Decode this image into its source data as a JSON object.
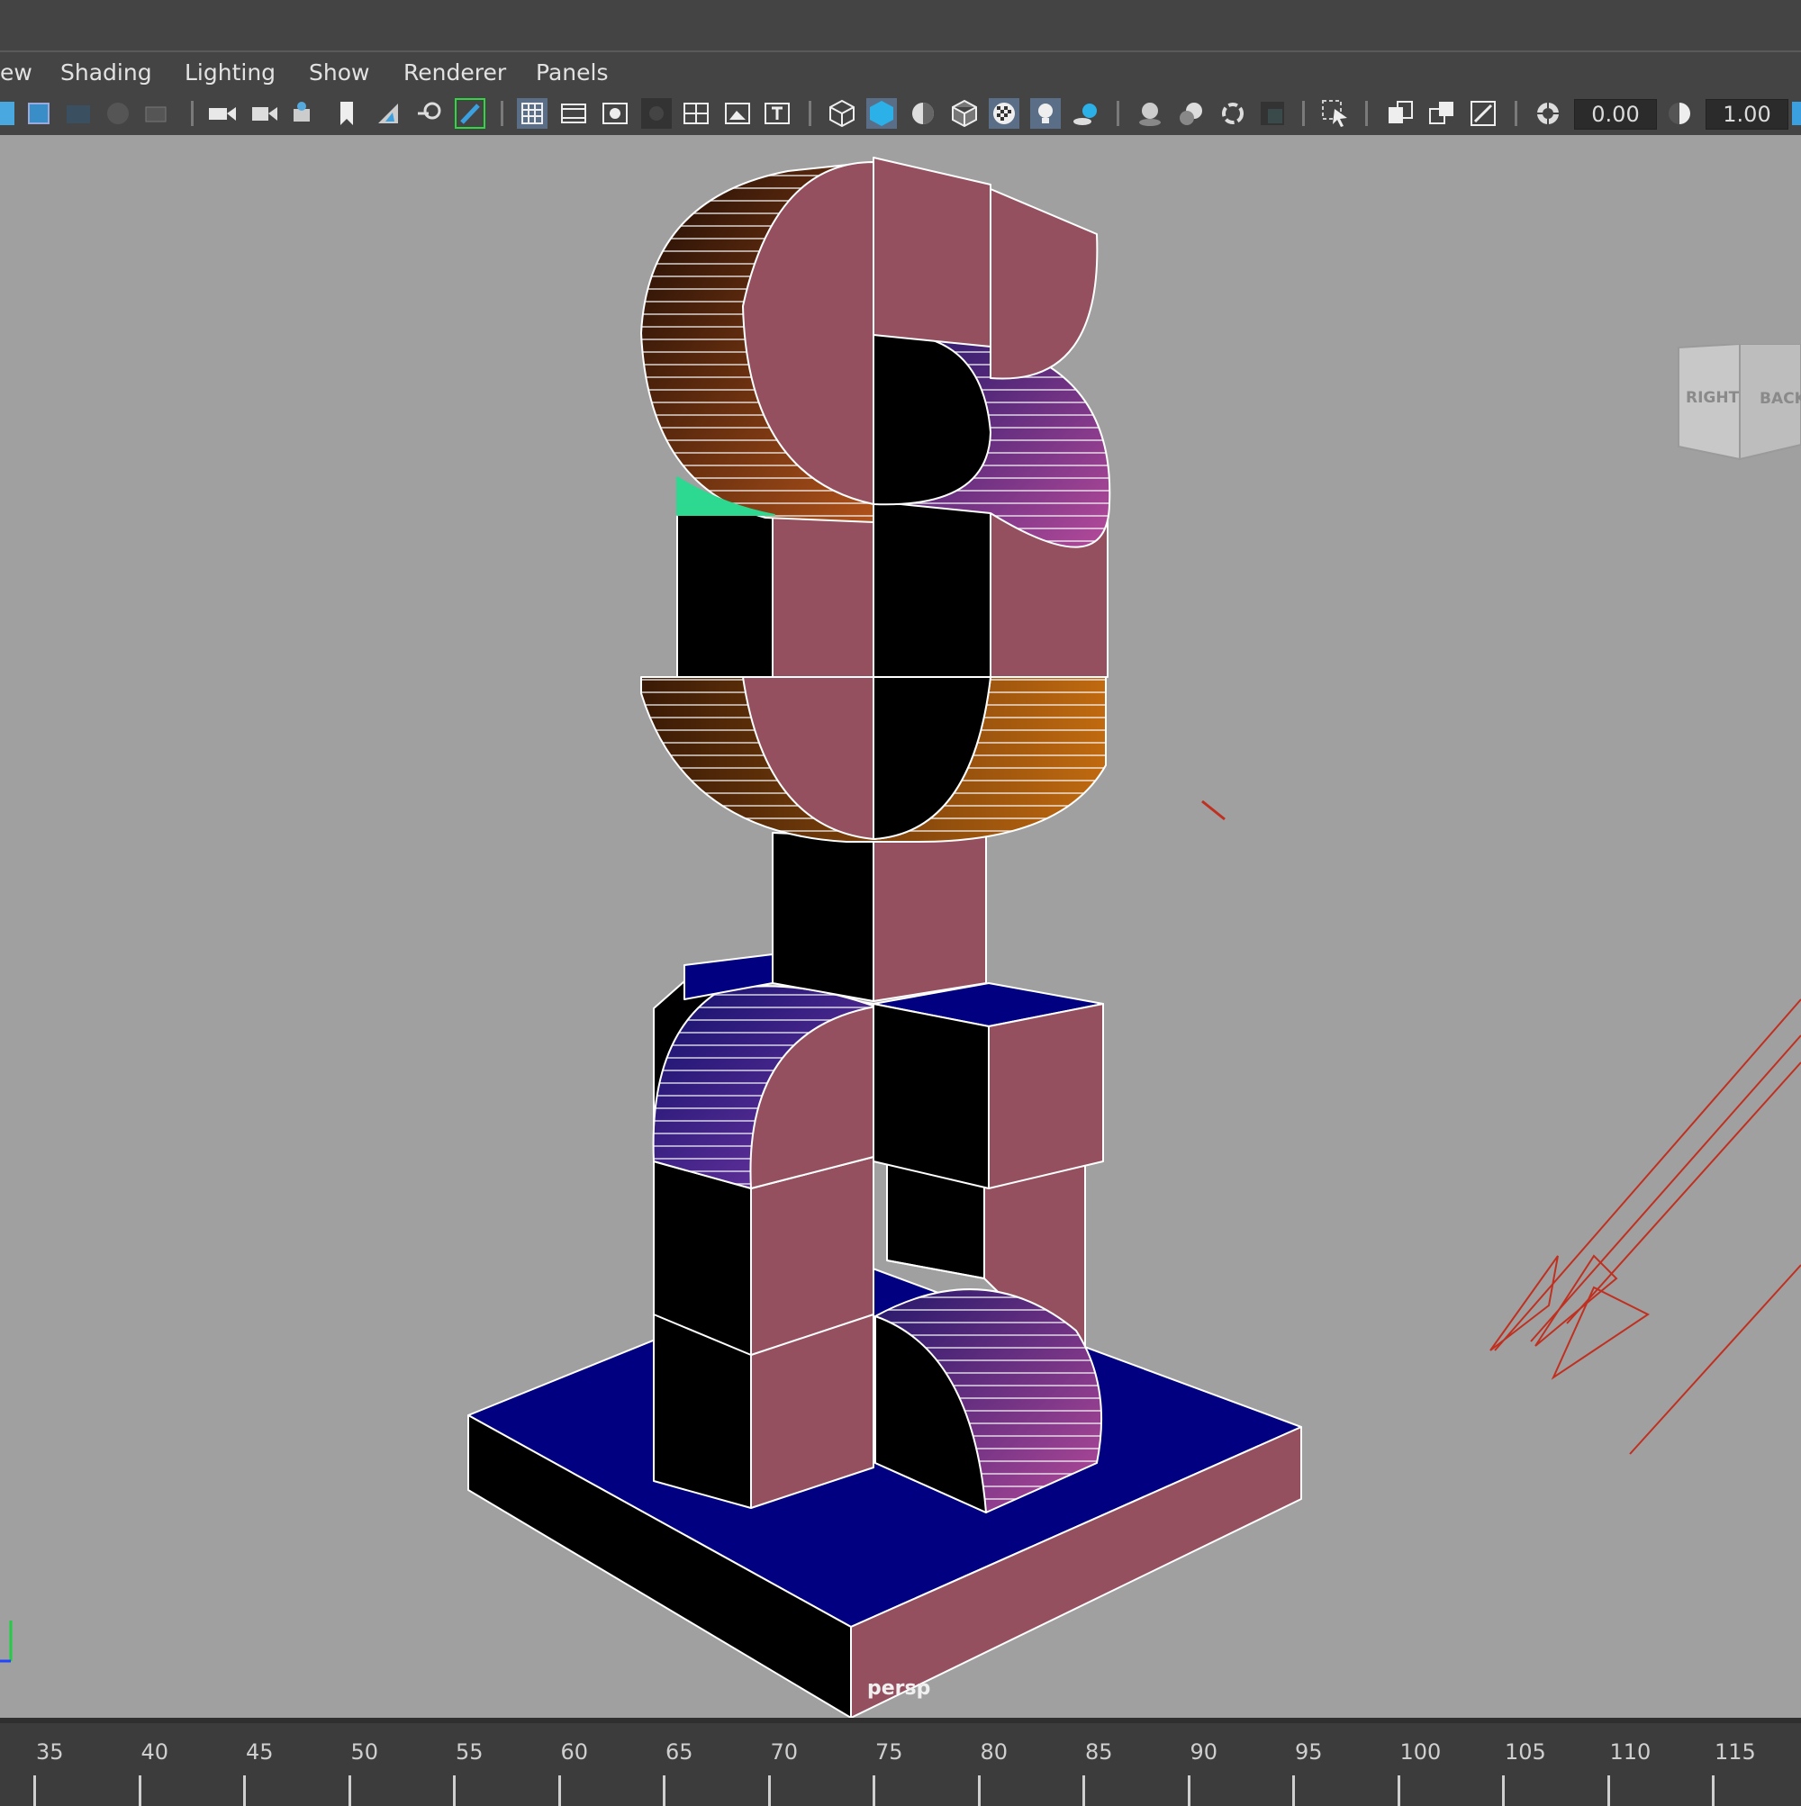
{
  "menu": [
    "ew",
    "Shading",
    "Lighting",
    "Show",
    "Renderer",
    "Panels"
  ],
  "toolbar": {
    "near_clip_value": "0.00",
    "far_clip_value": "1.00",
    "icons": [
      "select-camera-icon",
      "frame-all-icon",
      "grid-icon",
      "film-gate-icon",
      "resolution-gate-icon",
      "safe-action-icon",
      "wireframe-icon",
      "smooth-shade-icon",
      "textured-icon",
      "lights-icon",
      "shadows-icon",
      "isolate-select-icon",
      "xray-icon",
      "exposure-icon",
      "gamma-icon"
    ]
  },
  "viewport": {
    "camera_name": "persp",
    "viewcube": {
      "right_label": "RIGHT",
      "back_label": "BACK"
    }
  },
  "timeline": {
    "ticks": [
      "35",
      "40",
      "45",
      "50",
      "55",
      "60",
      "65",
      "70",
      "75",
      "80",
      "85",
      "90",
      "95",
      "100",
      "105",
      "110",
      "115"
    ]
  },
  "colors": {
    "viewport_bg": "#a0a0a0",
    "face_pink": "#955060",
    "face_blue": "#000080",
    "face_black": "#000000",
    "wire": "#ffffff",
    "light_gizmo": "#c03020"
  }
}
